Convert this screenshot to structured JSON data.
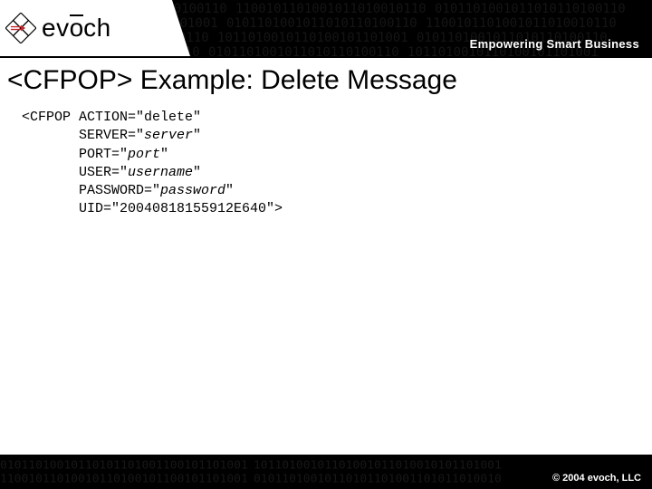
{
  "brand": {
    "part1": "ev",
    "part2": "o",
    "part3": "ch"
  },
  "tagline": "Empowering Smart Business",
  "title": "<CFPOP> Example: Delete Message",
  "code": {
    "l1_a": "<CFPOP ACTION=\"",
    "l1_b": "delete",
    "l1_c": "\"",
    "l2_a": "SERVER=\"",
    "l2_b": "server",
    "l2_c": "\"",
    "l3_a": "PORT=\"",
    "l3_b": "port",
    "l3_c": "\"",
    "l4_a": "USER=\"",
    "l4_b": "username",
    "l4_c": "\"",
    "l5_a": "PASSWORD=\"",
    "l5_b": "password",
    "l5_c": "\"",
    "l6": "UID=\"20040818155912E640\">"
  },
  "copyright": "© 2004 evoch, LLC"
}
